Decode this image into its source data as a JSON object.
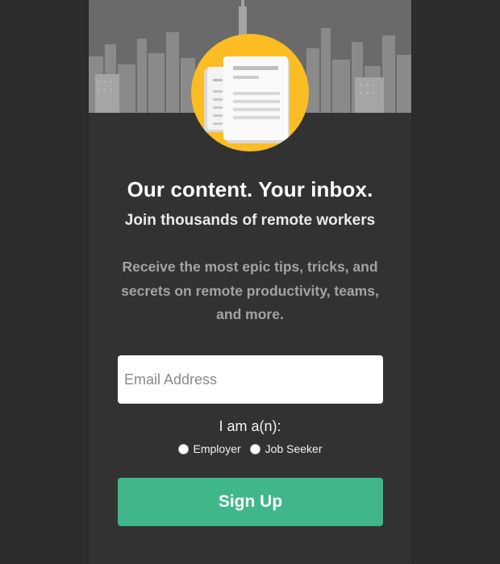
{
  "newsletter": {
    "headline": "Our content. Your inbox.",
    "subheadline": "Join thousands of remote workers",
    "description": "Receive the most epic tips, tricks, and secrets on remote productivity, teams, and more.",
    "email_placeholder": "Email Address",
    "role_label": "I am a(n):",
    "roles": [
      {
        "label": "Employer",
        "selected": false
      },
      {
        "label": "Job Seeker",
        "selected": false
      }
    ],
    "signup_label": "Sign Up"
  },
  "colors": {
    "background": "#2e2e2e",
    "panel": "#323232",
    "badge": "#fbbd22",
    "button": "#3fb78a"
  },
  "icons": {
    "hero": "city-skyline-image",
    "badge": "documents-icon"
  }
}
